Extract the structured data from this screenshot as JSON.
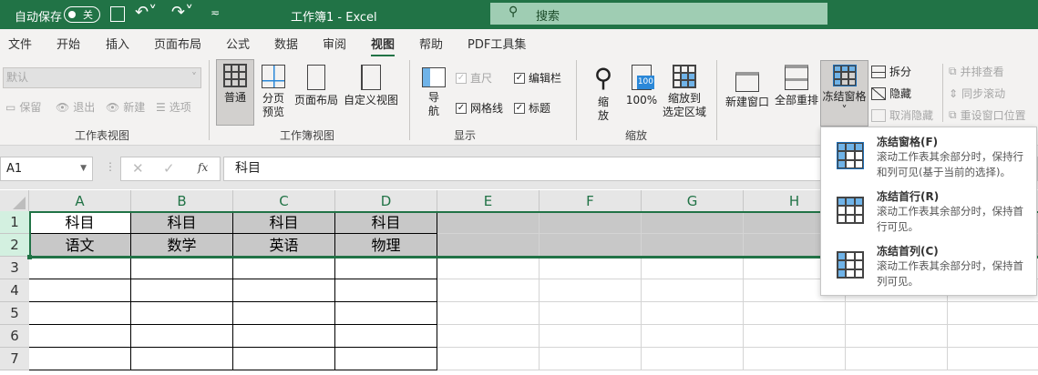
{
  "titlebar": {
    "autosave_label": "自动保存",
    "autosave_state": "关",
    "title": "工作簿1  -  Excel",
    "search_placeholder": "搜索"
  },
  "tabs": [
    "文件",
    "开始",
    "插入",
    "页面布局",
    "公式",
    "数据",
    "审阅",
    "视图",
    "帮助",
    "PDF工具集"
  ],
  "active_tab": "视图",
  "ribbon": {
    "sheet_view": {
      "dropdown_value": "默认",
      "keep": "保留",
      "exit": "退出",
      "new": "新建",
      "options": "选项",
      "group": "工作表视图"
    },
    "workbook_view": {
      "normal": "普通",
      "page_break_1": "分页",
      "page_break_2": "预览",
      "page_layout": "页面布局",
      "custom": "自定义视图",
      "group": "工作簿视图"
    },
    "show": {
      "nav_1": "导",
      "nav_2": "航",
      "ruler": "直尺",
      "formula_bar": "编辑栏",
      "gridlines": "网格线",
      "headings": "标题",
      "group": "显示"
    },
    "zoom": {
      "zoom_1": "缩",
      "zoom_2": "放",
      "hundred": "100%",
      "icon_100": "100",
      "sel_1": "缩放到",
      "sel_2": "选定区域",
      "group": "缩放"
    },
    "window": {
      "new_window": "新建窗口",
      "arrange_all": "全部重排",
      "freeze": "冻结窗格",
      "split": "拆分",
      "hide": "隐藏",
      "unhide": "取消隐藏",
      "side_by_side": "并排查看",
      "sync_scroll": "同步滚动",
      "reset_pos": "重设窗口位置"
    }
  },
  "formula_bar": {
    "name_box": "A1",
    "fx": "fx",
    "value": "科目"
  },
  "columns": [
    "A",
    "B",
    "C",
    "D",
    "E",
    "F",
    "G",
    "H"
  ],
  "rows": [
    "1",
    "2",
    "3",
    "4",
    "5",
    "6",
    "7"
  ],
  "cells": {
    "row1": [
      "科目",
      "科目",
      "科目",
      "科目"
    ],
    "row2": [
      "语文",
      "数学",
      "英语",
      "物理"
    ]
  },
  "freeze_menu": [
    {
      "title": "冻结窗格(F)",
      "desc": "滚动工作表其余部分时，保持行和列可见(基于当前的选择)。"
    },
    {
      "title": "冻结首行(R)",
      "desc": "滚动工作表其余部分时，保持首行可见。"
    },
    {
      "title": "冻结首列(C)",
      "desc": "滚动工作表其余部分时，保持首列可见。"
    }
  ],
  "colors": {
    "brand": "#217346",
    "accent_blue": "#2b88d8",
    "selected_fill": "#c8c8c8"
  }
}
